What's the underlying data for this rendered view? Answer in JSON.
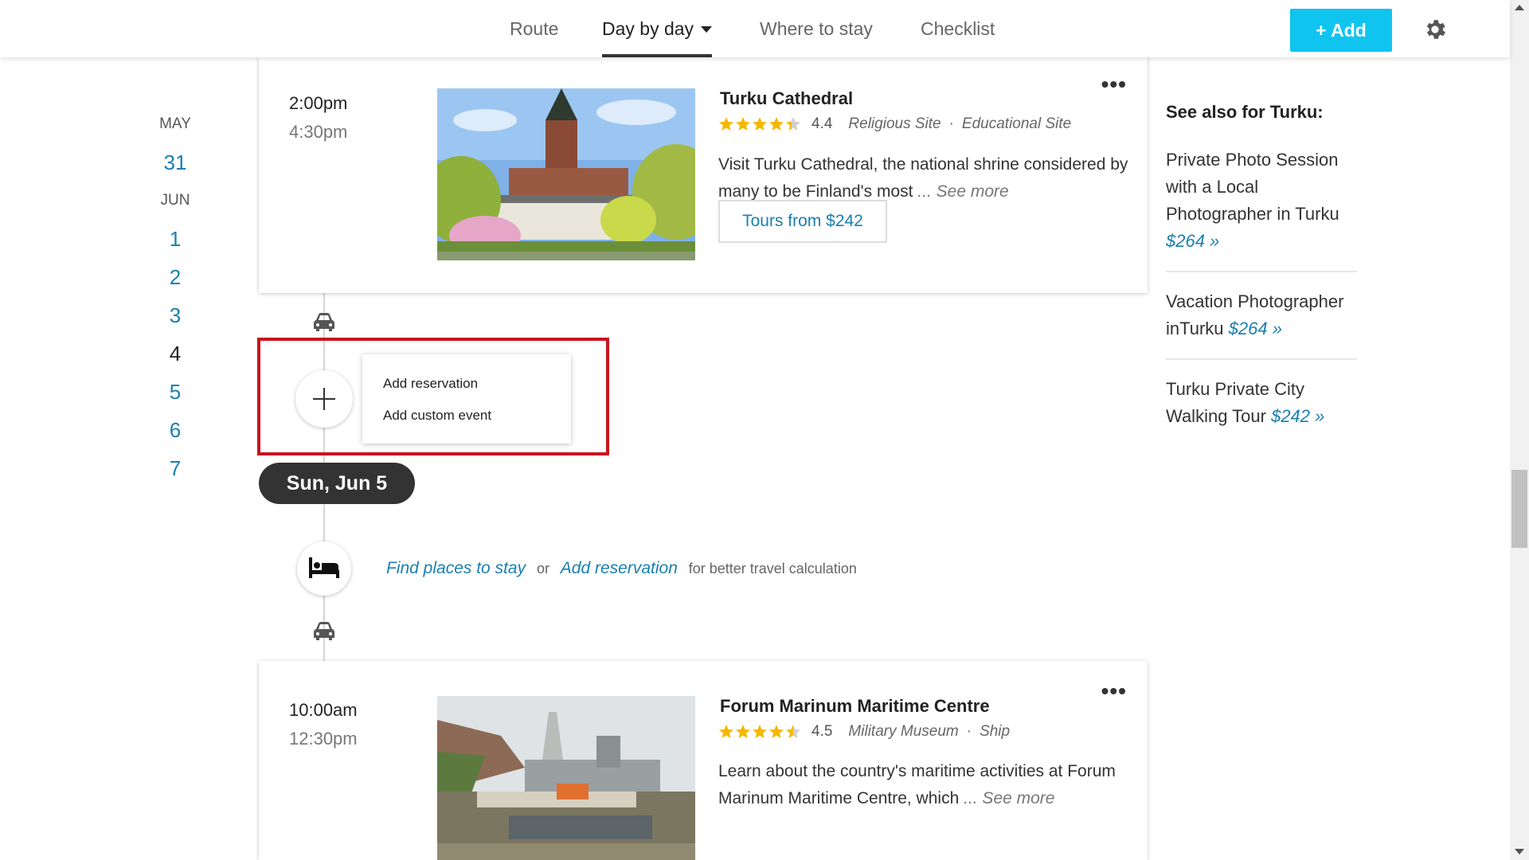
{
  "nav": {
    "tabs": [
      {
        "label": "Route"
      },
      {
        "label": "Day by day"
      },
      {
        "label": "Where to stay"
      },
      {
        "label": "Checklist"
      }
    ],
    "active_tab": "Day by day",
    "add_label": "+ Add",
    "settings_icon": "gear-icon",
    "accent_color": "#10c4f0"
  },
  "dates": {
    "month1": "MAY",
    "days1": [
      "31"
    ],
    "month2": "JUN",
    "days2": [
      "1",
      "2",
      "3",
      "4",
      "5",
      "6",
      "7"
    ],
    "current_day": "4"
  },
  "card1": {
    "start": "2:00pm",
    "end": "4:30pm",
    "title": "Turku Cathedral",
    "rating": "4.4",
    "rating_value": 4.4,
    "cat1": "Religious Site",
    "cat2": "Educational Site",
    "desc": "Visit Turku Cathedral, the national shrine considered by many to be Finland's most",
    "more": "... See more",
    "tours_label": "Tours from $242",
    "menu": "•••"
  },
  "add_menu": {
    "opt1": "Add reservation",
    "opt2": "Add custom event"
  },
  "day_pill": "Sun, Jun 5",
  "stay": {
    "find": "Find places to stay",
    "or": "or",
    "add": "Add reservation",
    "suffix": "for better travel calculation"
  },
  "card2": {
    "start": "10:00am",
    "end": "12:30pm",
    "title": "Forum Marinum Maritime Centre",
    "rating": "4.5",
    "rating_value": 4.5,
    "cat1": "Military Museum",
    "cat2": "Ship",
    "desc": "Learn about the country's maritime activities at Forum Marinum Maritime Centre, which",
    "more": "... See more",
    "menu": "•••"
  },
  "side": {
    "title": "See also for Turku:",
    "items": [
      {
        "text": "Private Photo Session with a Local Photographer in Turku",
        "price": "$264 »"
      },
      {
        "text": "Vacation Photographer inTurku",
        "price": "$264 »"
      },
      {
        "text": "Turku Private City Walking Tour",
        "price": "$242 »"
      }
    ]
  }
}
